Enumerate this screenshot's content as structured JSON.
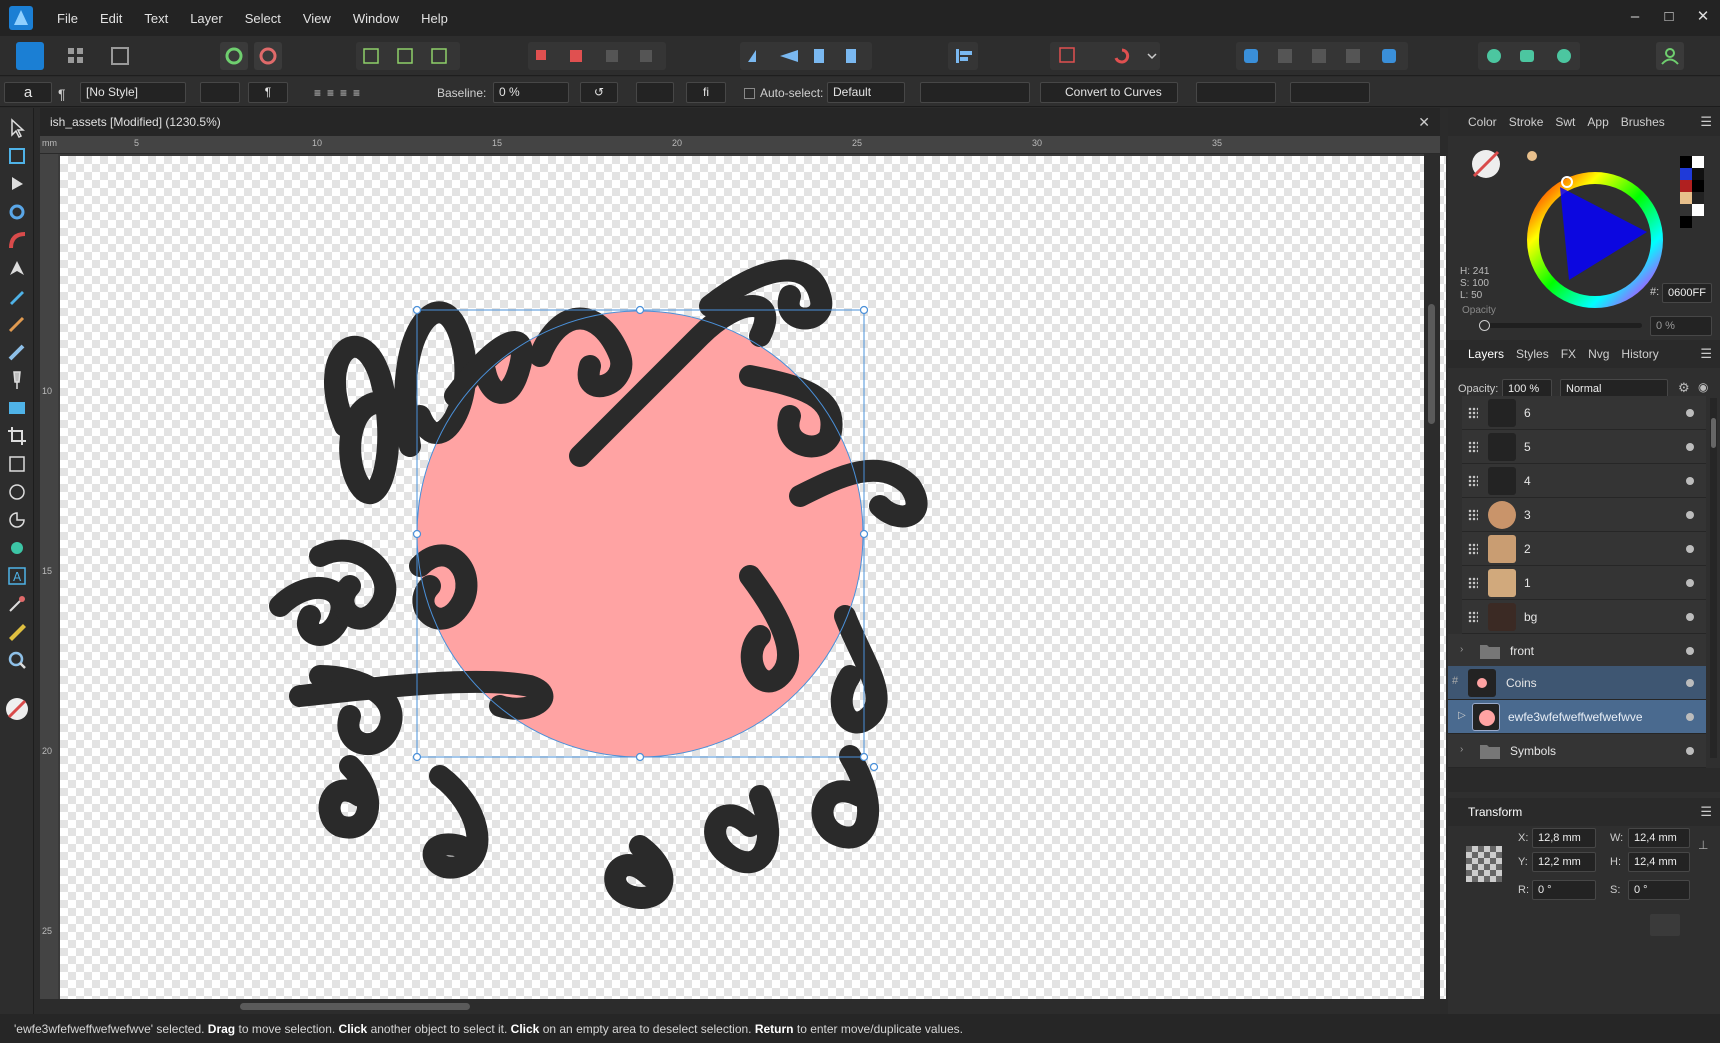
{
  "menu": {
    "items": [
      "File",
      "Edit",
      "Text",
      "Layer",
      "Select",
      "View",
      "Window",
      "Help"
    ]
  },
  "context": {
    "font_char": "a",
    "style": "[No Style]",
    "baseline_label": "Baseline:",
    "baseline_value": "0 %",
    "ligature": "fi",
    "autoselect_label": "Auto-select:",
    "autoselect_value": "Default",
    "convert_label": "Convert to Curves"
  },
  "document": {
    "tab_title": "ish_assets [Modified] (1230.5%)",
    "ruler_unit": "mm",
    "hruler_ticks": [
      "5",
      "10",
      "15",
      "20",
      "25",
      "30",
      "35"
    ],
    "vruler_ticks": [
      "10",
      "15",
      "20",
      "25"
    ]
  },
  "color_panel": {
    "tabs": [
      "Color",
      "Stroke",
      "Swt",
      "App",
      "Brushes"
    ],
    "h": "H: 241",
    "s": "S: 100",
    "l": "L: 50",
    "hex_label": "#:",
    "hex_value": "0600FF",
    "opacity_label": "Opacity",
    "opacity_value": "0 %",
    "accent": "#0600FF"
  },
  "layers_panel": {
    "tabs": [
      "Layers",
      "Styles",
      "FX",
      "Nvg",
      "History"
    ],
    "opacity_label": "Opacity:",
    "opacity_value": "100 %",
    "blend_mode": "Normal",
    "rows": [
      {
        "name": "6"
      },
      {
        "name": "5"
      },
      {
        "name": "4"
      },
      {
        "name": "3"
      },
      {
        "name": "2"
      },
      {
        "name": "1"
      },
      {
        "name": "bg"
      },
      {
        "name": "front"
      },
      {
        "name": "Coins"
      },
      {
        "name": "ewfe3wfefweffwefwefwve"
      },
      {
        "name": "Symbols"
      }
    ]
  },
  "transform_panel": {
    "title": "Transform",
    "x_label": "X:",
    "x_value": "12,8 mm",
    "y_label": "Y:",
    "y_value": "12,2 mm",
    "w_label": "W:",
    "w_value": "12,4 mm",
    "h_label": "H:",
    "h_value": "12,4 mm",
    "r_label": "R:",
    "r_value": "0 °",
    "s_label": "S:",
    "s_value": "0 °"
  },
  "status": {
    "sel": "'ewfe3wfefweffwefwefwve' selected.",
    "drag": "Drag",
    "t1": "to move selection.",
    "click": "Click",
    "t2": "another object to select it.",
    "click2": "Click",
    "t3": "on an empty area to deselect selection.",
    "ret": "Return",
    "t4": "to enter move/duplicate values."
  },
  "colors": {
    "fill_pink": "#FFA3A3",
    "ink": "#2a2a2a",
    "selection": "#4a90d9",
    "selected_row": "#4a6a8f"
  }
}
